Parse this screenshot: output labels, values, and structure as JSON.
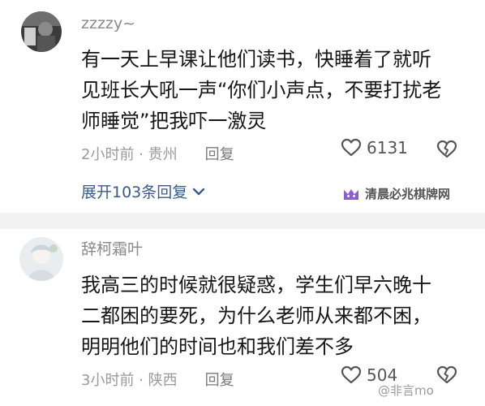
{
  "comments": [
    {
      "username": "zzzzy~",
      "lines": [
        "有一天上早课让他们读书，快睡着了就听",
        "见班长大吼一声“你们小声点，不要打扰老",
        "师睡觉”把我吓一激灵"
      ],
      "time_location": "2小时前 · 贵州",
      "reply_label": "回复",
      "likes": "6131",
      "expand_label": "展开103条回复"
    },
    {
      "username": "辞柯霜叶",
      "lines": [
        "我高三的时候就很疑惑，学生们早六晚十",
        "二都困的要死，为什么老师从来都不困，",
        "明明他们的时间也和我们差不多"
      ],
      "time_location": "3小时前 · 陕西",
      "reply_label": "回复",
      "likes": "504"
    }
  ],
  "watermarks": {
    "brand": "清晨必兆棋牌网",
    "bottom": "@非言mo"
  },
  "icons": {
    "like": "heart-outline-icon",
    "dislike": "broken-heart-icon",
    "expand": "chevron-down-icon",
    "brand": "brand-logo-icon"
  },
  "colors": {
    "link": "#3a5a8c",
    "meta": "#9a9a9a",
    "divider": "#f2f2f4"
  }
}
